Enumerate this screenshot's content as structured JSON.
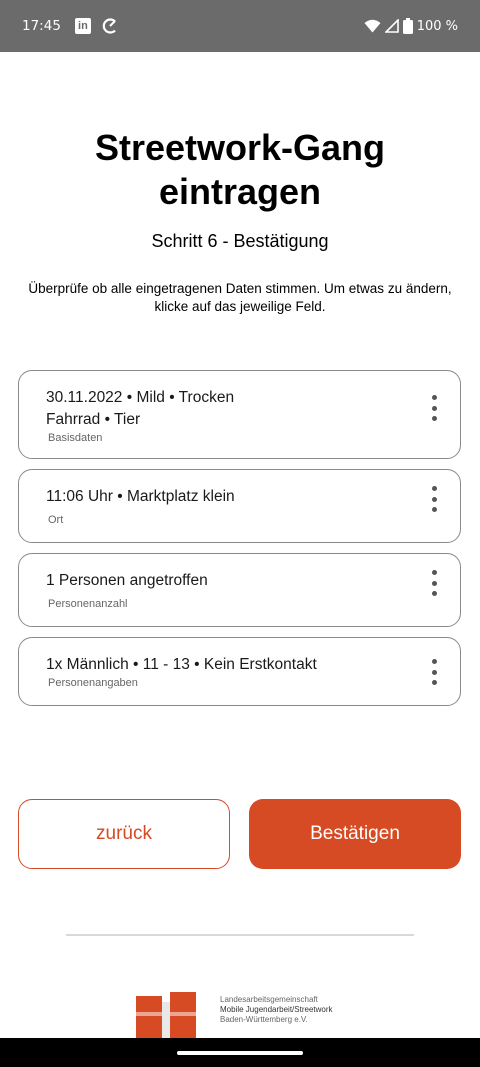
{
  "status_bar": {
    "time": "17:45",
    "battery": "100 %"
  },
  "header": {
    "title_line1": "Streetwork-Gang",
    "title_line2": "eintragen",
    "step": "Schritt 6 - Bestätigung"
  },
  "intro": "Überprüfe ob alle eingetragenen Daten stimmen. Um etwas zu ändern, klicke auf das jeweilige Feld.",
  "cards": [
    {
      "line1": "30.11.2022 • Mild • Trocken",
      "line2": "Fahrrad • Tier",
      "caption": "Basisdaten"
    },
    {
      "line1": "11:06 Uhr • Marktplatz klein",
      "caption": "Ort"
    },
    {
      "line1": "1 Personen angetroffen",
      "caption": "Personenanzahl"
    },
    {
      "line1": "1x Männlich • 11 - 13 • Kein Erstkontakt",
      "caption": "Personenangaben"
    }
  ],
  "buttons": {
    "back": "zurück",
    "confirm": "Bestätigen"
  },
  "footer": {
    "logo_line1": "Landesarbeitsgemeinschaft",
    "logo_line2": "Mobile Jugendarbeit/Streetwork",
    "logo_line3": "Baden-Württemberg e.V."
  },
  "colors": {
    "accent": "#d64a24",
    "status_bar": "#6b6b6b"
  },
  "icons": [
    "linkedin-icon",
    "sync-icon",
    "wifi-icon",
    "signal-icon",
    "battery-icon",
    "more-vert-icon"
  ]
}
